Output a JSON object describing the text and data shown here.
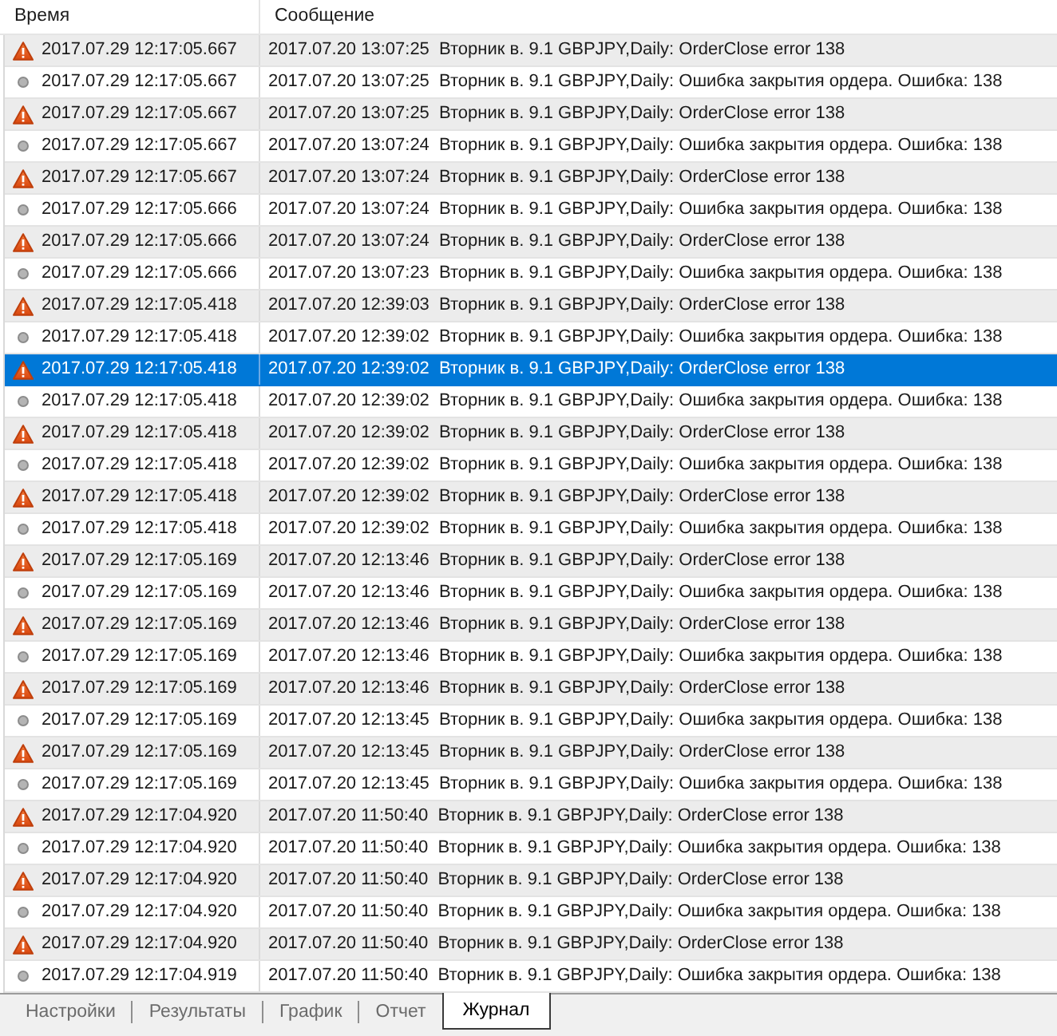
{
  "columns": [
    "Время",
    "Сообщение"
  ],
  "rows": [
    {
      "kind": "warning",
      "time": "2017.07.29 12:17:05.667",
      "message": "2017.07.20 13:07:25  Вторник в. 9.1 GBPJPY,Daily: OrderClose error 138",
      "selected": false
    },
    {
      "kind": "info",
      "time": "2017.07.29 12:17:05.667",
      "message": "2017.07.20 13:07:25  Вторник в. 9.1 GBPJPY,Daily: Ошибка закрытия ордера. Ошибка: 138",
      "selected": false
    },
    {
      "kind": "warning",
      "time": "2017.07.29 12:17:05.667",
      "message": "2017.07.20 13:07:25  Вторник в. 9.1 GBPJPY,Daily: OrderClose error 138",
      "selected": false
    },
    {
      "kind": "info",
      "time": "2017.07.29 12:17:05.667",
      "message": "2017.07.20 13:07:24  Вторник в. 9.1 GBPJPY,Daily: Ошибка закрытия ордера. Ошибка: 138",
      "selected": false
    },
    {
      "kind": "warning",
      "time": "2017.07.29 12:17:05.667",
      "message": "2017.07.20 13:07:24  Вторник в. 9.1 GBPJPY,Daily: OrderClose error 138",
      "selected": false
    },
    {
      "kind": "info",
      "time": "2017.07.29 12:17:05.666",
      "message": "2017.07.20 13:07:24  Вторник в. 9.1 GBPJPY,Daily: Ошибка закрытия ордера. Ошибка: 138",
      "selected": false
    },
    {
      "kind": "warning",
      "time": "2017.07.29 12:17:05.666",
      "message": "2017.07.20 13:07:24  Вторник в. 9.1 GBPJPY,Daily: OrderClose error 138",
      "selected": false
    },
    {
      "kind": "info",
      "time": "2017.07.29 12:17:05.666",
      "message": "2017.07.20 13:07:23  Вторник в. 9.1 GBPJPY,Daily: Ошибка закрытия ордера. Ошибка: 138",
      "selected": false
    },
    {
      "kind": "warning",
      "time": "2017.07.29 12:17:05.418",
      "message": "2017.07.20 12:39:03  Вторник в. 9.1 GBPJPY,Daily: OrderClose error 138",
      "selected": false
    },
    {
      "kind": "info",
      "time": "2017.07.29 12:17:05.418",
      "message": "2017.07.20 12:39:02  Вторник в. 9.1 GBPJPY,Daily: Ошибка закрытия ордера. Ошибка: 138",
      "selected": false
    },
    {
      "kind": "warning",
      "time": "2017.07.29 12:17:05.418",
      "message": "2017.07.20 12:39:02  Вторник в. 9.1 GBPJPY,Daily: OrderClose error 138",
      "selected": true
    },
    {
      "kind": "info",
      "time": "2017.07.29 12:17:05.418",
      "message": "2017.07.20 12:39:02  Вторник в. 9.1 GBPJPY,Daily: Ошибка закрытия ордера. Ошибка: 138",
      "selected": false
    },
    {
      "kind": "warning",
      "time": "2017.07.29 12:17:05.418",
      "message": "2017.07.20 12:39:02  Вторник в. 9.1 GBPJPY,Daily: OrderClose error 138",
      "selected": false
    },
    {
      "kind": "info",
      "time": "2017.07.29 12:17:05.418",
      "message": "2017.07.20 12:39:02  Вторник в. 9.1 GBPJPY,Daily: Ошибка закрытия ордера. Ошибка: 138",
      "selected": false
    },
    {
      "kind": "warning",
      "time": "2017.07.29 12:17:05.418",
      "message": "2017.07.20 12:39:02  Вторник в. 9.1 GBPJPY,Daily: OrderClose error 138",
      "selected": false
    },
    {
      "kind": "info",
      "time": "2017.07.29 12:17:05.418",
      "message": "2017.07.20 12:39:02  Вторник в. 9.1 GBPJPY,Daily: Ошибка закрытия ордера. Ошибка: 138",
      "selected": false
    },
    {
      "kind": "warning",
      "time": "2017.07.29 12:17:05.169",
      "message": "2017.07.20 12:13:46  Вторник в. 9.1 GBPJPY,Daily: OrderClose error 138",
      "selected": false
    },
    {
      "kind": "info",
      "time": "2017.07.29 12:17:05.169",
      "message": "2017.07.20 12:13:46  Вторник в. 9.1 GBPJPY,Daily: Ошибка закрытия ордера. Ошибка: 138",
      "selected": false
    },
    {
      "kind": "warning",
      "time": "2017.07.29 12:17:05.169",
      "message": "2017.07.20 12:13:46  Вторник в. 9.1 GBPJPY,Daily: OrderClose error 138",
      "selected": false
    },
    {
      "kind": "info",
      "time": "2017.07.29 12:17:05.169",
      "message": "2017.07.20 12:13:46  Вторник в. 9.1 GBPJPY,Daily: Ошибка закрытия ордера. Ошибка: 138",
      "selected": false
    },
    {
      "kind": "warning",
      "time": "2017.07.29 12:17:05.169",
      "message": "2017.07.20 12:13:46  Вторник в. 9.1 GBPJPY,Daily: OrderClose error 138",
      "selected": false
    },
    {
      "kind": "info",
      "time": "2017.07.29 12:17:05.169",
      "message": "2017.07.20 12:13:45  Вторник в. 9.1 GBPJPY,Daily: Ошибка закрытия ордера. Ошибка: 138",
      "selected": false
    },
    {
      "kind": "warning",
      "time": "2017.07.29 12:17:05.169",
      "message": "2017.07.20 12:13:45  Вторник в. 9.1 GBPJPY,Daily: OrderClose error 138",
      "selected": false
    },
    {
      "kind": "info",
      "time": "2017.07.29 12:17:05.169",
      "message": "2017.07.20 12:13:45  Вторник в. 9.1 GBPJPY,Daily: Ошибка закрытия ордера. Ошибка: 138",
      "selected": false
    },
    {
      "kind": "warning",
      "time": "2017.07.29 12:17:04.920",
      "message": "2017.07.20 11:50:40  Вторник в. 9.1 GBPJPY,Daily: OrderClose error 138",
      "selected": false
    },
    {
      "kind": "info",
      "time": "2017.07.29 12:17:04.920",
      "message": "2017.07.20 11:50:40  Вторник в. 9.1 GBPJPY,Daily: Ошибка закрытия ордера. Ошибка: 138",
      "selected": false
    },
    {
      "kind": "warning",
      "time": "2017.07.29 12:17:04.920",
      "message": "2017.07.20 11:50:40  Вторник в. 9.1 GBPJPY,Daily: OrderClose error 138",
      "selected": false
    },
    {
      "kind": "info",
      "time": "2017.07.29 12:17:04.920",
      "message": "2017.07.20 11:50:40  Вторник в. 9.1 GBPJPY,Daily: Ошибка закрытия ордера. Ошибка: 138",
      "selected": false
    },
    {
      "kind": "warning",
      "time": "2017.07.29 12:17:04.920",
      "message": "2017.07.20 11:50:40  Вторник в. 9.1 GBPJPY,Daily: OrderClose error 138",
      "selected": false
    },
    {
      "kind": "info",
      "time": "2017.07.29 12:17:04.919",
      "message": "2017.07.20 11:50:40  Вторник в. 9.1 GBPJPY,Daily: Ошибка закрытия ордера. Ошибка: 138",
      "selected": false
    }
  ],
  "tabs": [
    {
      "label": "Настройки",
      "selected": false
    },
    {
      "label": "Результаты",
      "selected": false
    },
    {
      "label": "График",
      "selected": false
    },
    {
      "label": "Отчет",
      "selected": false
    },
    {
      "label": "Журнал",
      "selected": true
    }
  ]
}
